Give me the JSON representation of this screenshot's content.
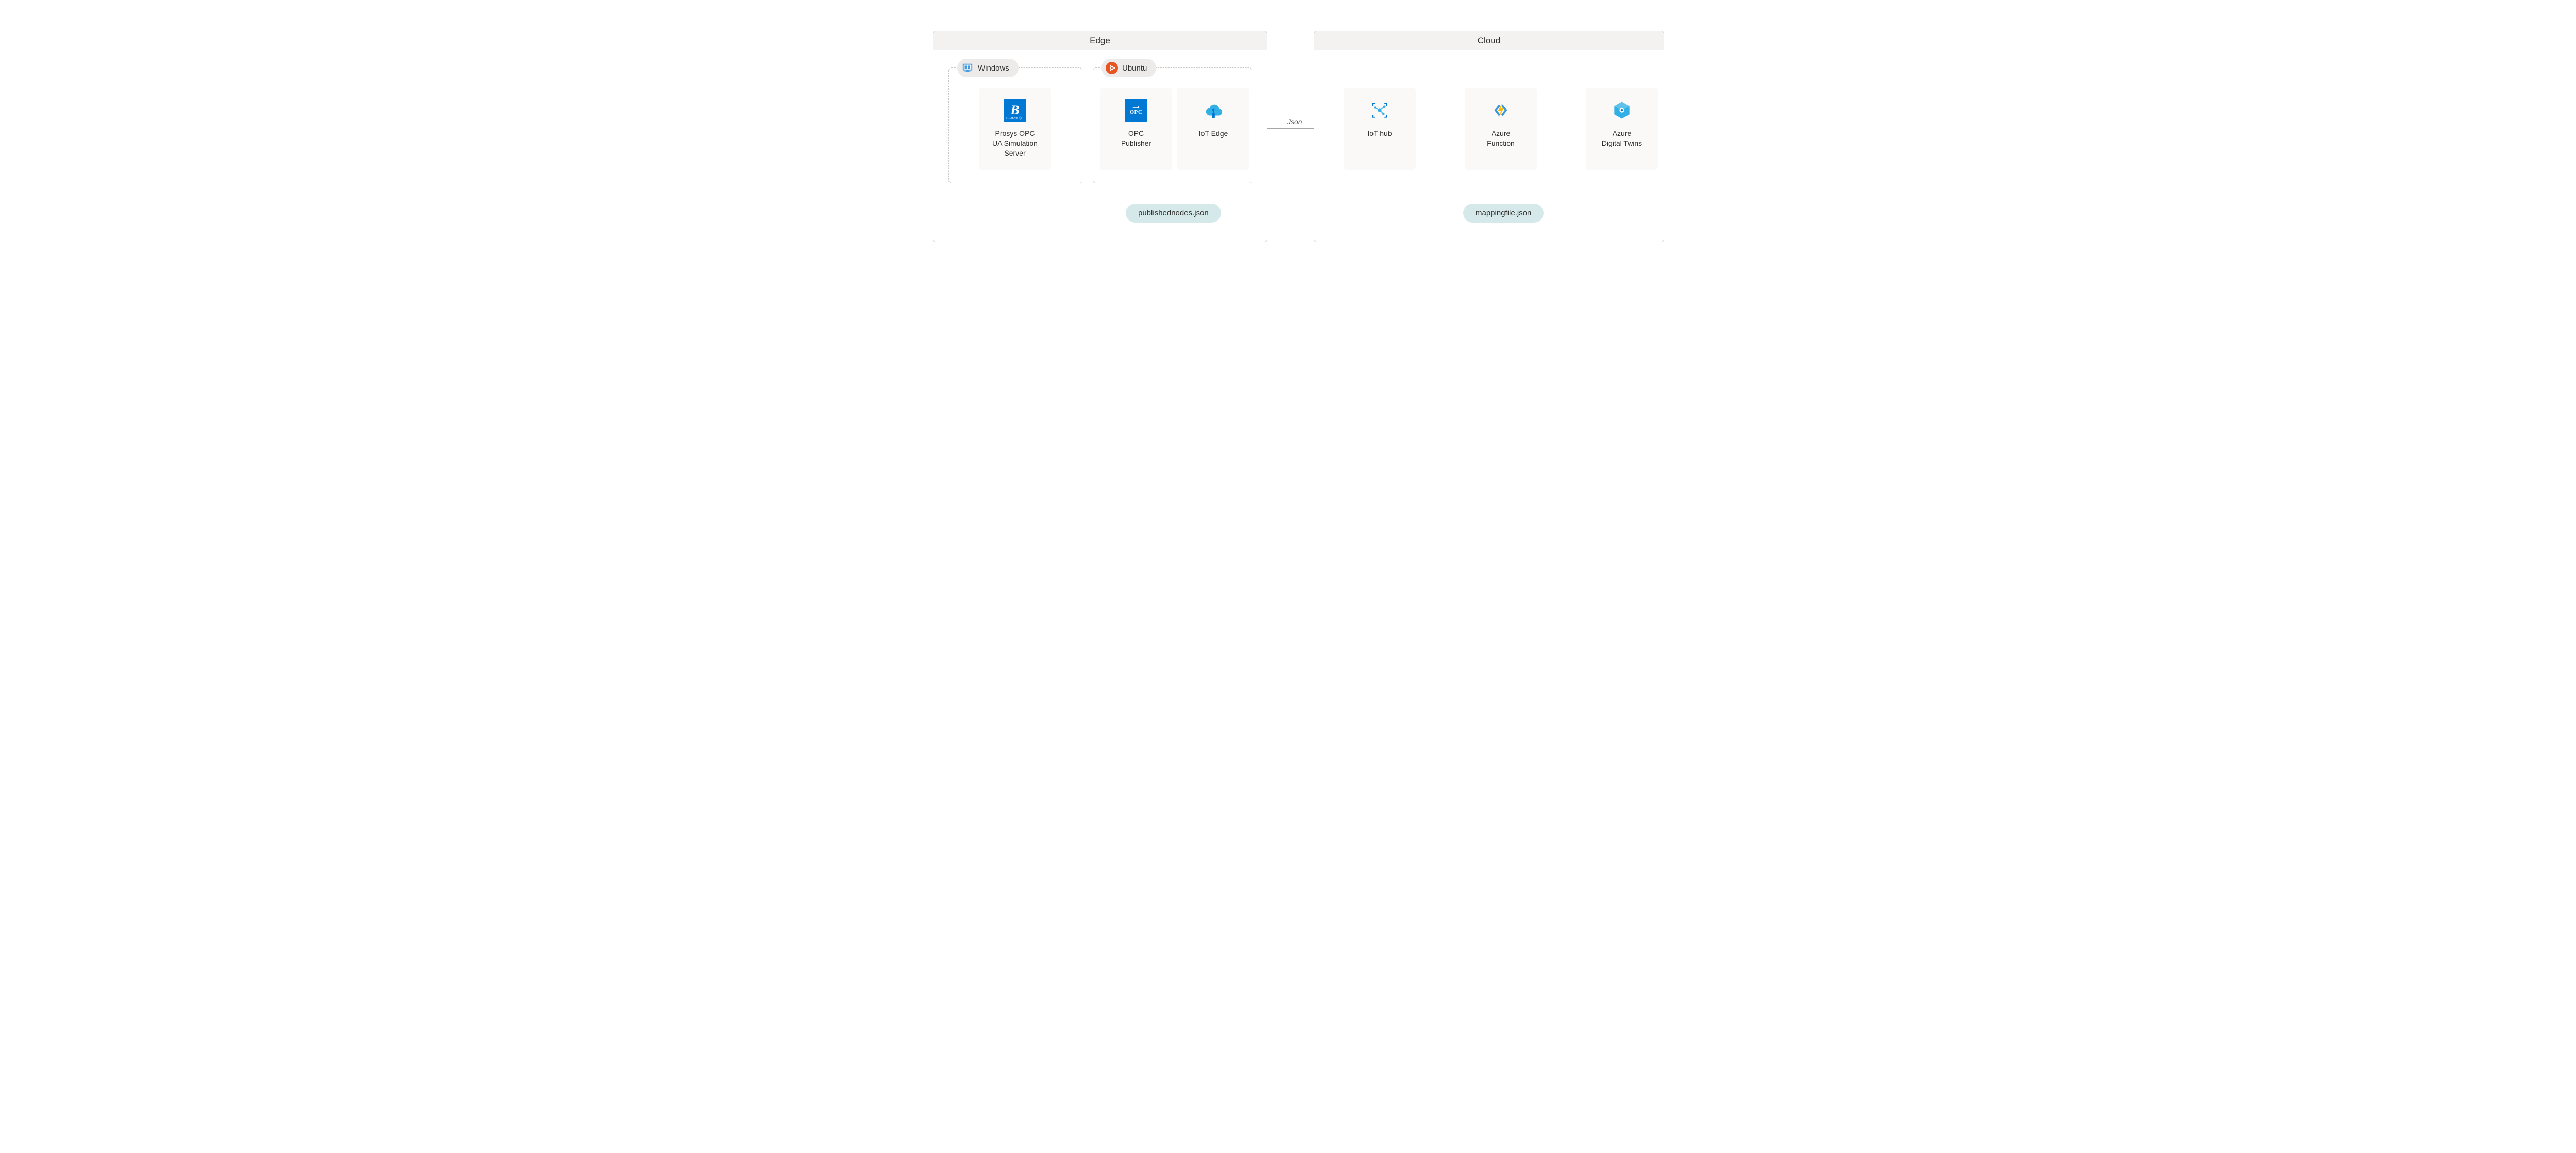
{
  "panels": {
    "edge": {
      "title": "Edge"
    },
    "cloud": {
      "title": "Cloud"
    }
  },
  "subgroups": {
    "windows": {
      "label": "Windows"
    },
    "ubuntu": {
      "label": "Ubuntu"
    }
  },
  "nodes": {
    "prosys": {
      "label": "Prosys OPC\nUA Simulation\nServer"
    },
    "opcpub": {
      "label": "OPC\nPublisher"
    },
    "iotedge": {
      "label": "IoT Edge"
    },
    "iothub": {
      "label": "IoT hub"
    },
    "func": {
      "label": "Azure\nFunction"
    },
    "adt": {
      "label": "Azure\nDigital Twins"
    }
  },
  "files": {
    "pn": {
      "label": "publishednodes.json"
    },
    "map": {
      "label": "mappingfile.json"
    }
  },
  "arrows": {
    "json": {
      "label": "Json"
    }
  },
  "colors": {
    "ubuntu": "#e95420",
    "azure": "#0078d4",
    "teal": "#d6e9ea",
    "yellow": "#ffb900",
    "cloudBlue": "#32b0e6"
  }
}
